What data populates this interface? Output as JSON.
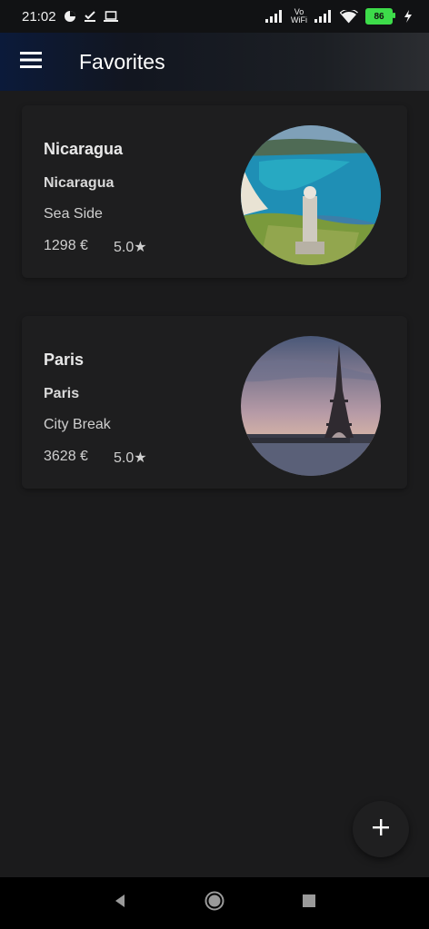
{
  "status_bar": {
    "time": "21:02",
    "battery_level": "86",
    "icons": [
      "pie-chart-icon",
      "download-done-icon",
      "laptop-icon",
      "signal-icon",
      "vowifi-icon",
      "signal-icon",
      "wifi-icon",
      "battery-icon",
      "charging-icon"
    ],
    "vowifi_label_top": "Vo",
    "vowifi_label_bottom": "WiFi"
  },
  "app_bar": {
    "title": "Favorites",
    "menu_icon": "hamburger-menu-icon"
  },
  "favorites": [
    {
      "title": "Nicaragua",
      "subtitle": "Nicaragua",
      "type": "Sea Side",
      "price": "1298 €",
      "rating": "5.0★",
      "image": "coastal-bay-statue-photo"
    },
    {
      "title": "Paris",
      "subtitle": "Paris",
      "type": "City Break",
      "price": "3628 €",
      "rating": "5.0★",
      "image": "eiffel-tower-sunset-photo"
    }
  ],
  "fab": {
    "icon": "plus-icon"
  },
  "nav_bar": {
    "icons": [
      "back-icon",
      "home-icon",
      "recents-icon"
    ]
  },
  "colors": {
    "background": "#1b1b1c",
    "card": "#1e1e1f",
    "app_bar_start": "#0b1a3a",
    "text_primary": "#e8e8e8",
    "battery": "#3ddc4a"
  }
}
